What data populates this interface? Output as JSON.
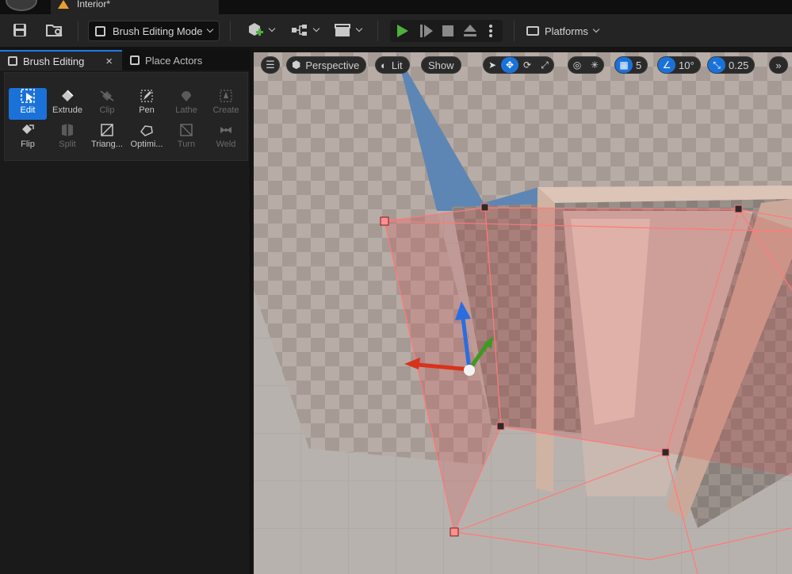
{
  "title_bar": {
    "level_name": "Interior*"
  },
  "toolbar": {
    "mode_label": "Brush Editing Mode",
    "platforms_label": "Platforms"
  },
  "panel": {
    "tabs": [
      {
        "label": "Brush Editing",
        "active": true
      },
      {
        "label": "Place Actors",
        "active": false
      }
    ],
    "close_glyph": "×",
    "tools": [
      {
        "label": "Edit",
        "icon": "cursor-icon",
        "state": "active"
      },
      {
        "label": "Extrude",
        "icon": "extrude-icon",
        "state": "enabled"
      },
      {
        "label": "Clip",
        "icon": "clip-icon",
        "state": "disabled"
      },
      {
        "label": "Pen",
        "icon": "pen-icon",
        "state": "enabled"
      },
      {
        "label": "Lathe",
        "icon": "lathe-icon",
        "state": "disabled"
      },
      {
        "label": "Create",
        "icon": "create-icon",
        "state": "disabled"
      },
      {
        "label": "Flip",
        "icon": "flip-icon",
        "state": "enabled"
      },
      {
        "label": "Split",
        "icon": "split-icon",
        "state": "disabled"
      },
      {
        "label": "Triang...",
        "icon": "triangulate-icon",
        "state": "enabled"
      },
      {
        "label": "Optimi...",
        "icon": "optimize-icon",
        "state": "enabled"
      },
      {
        "label": "Turn",
        "icon": "turn-icon",
        "state": "disabled"
      },
      {
        "label": "Weld",
        "icon": "weld-icon",
        "state": "disabled"
      }
    ]
  },
  "viewport": {
    "view_mode": "Perspective",
    "lighting": "Lit",
    "show_label": "Show",
    "grid_snap": "5",
    "rotation_snap": "10°",
    "scale_snap": "0.25"
  },
  "colors": {
    "accent": "#1a72d9",
    "play_green": "#4fb13c",
    "warning": "#e8a033",
    "brush_wire": "#ff7a7a"
  }
}
